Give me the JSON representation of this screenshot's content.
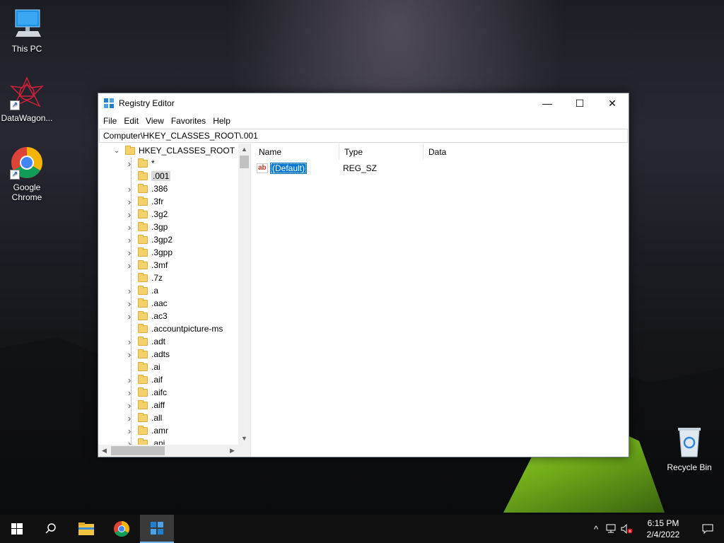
{
  "desktop": {
    "icons": [
      {
        "label": "This PC"
      },
      {
        "label": "DataWagon..."
      },
      {
        "label": "Google Chrome"
      },
      {
        "label": "Recycle Bin"
      }
    ]
  },
  "window": {
    "title": "Registry Editor",
    "controls": {
      "minimize": "—",
      "maximize": "☐",
      "close": "✕"
    },
    "menu": [
      "File",
      "Edit",
      "View",
      "Favorites",
      "Help"
    ],
    "address": "Computer\\HKEY_CLASSES_ROOT\\.001"
  },
  "tree": {
    "root": "HKEY_CLASSES_ROOT",
    "items": [
      {
        "label": "*",
        "expandable": true
      },
      {
        "label": ".001",
        "expandable": false,
        "selected": true
      },
      {
        "label": ".386",
        "expandable": true
      },
      {
        "label": ".3fr",
        "expandable": true
      },
      {
        "label": ".3g2",
        "expandable": true
      },
      {
        "label": ".3gp",
        "expandable": true
      },
      {
        "label": ".3gp2",
        "expandable": true
      },
      {
        "label": ".3gpp",
        "expandable": true
      },
      {
        "label": ".3mf",
        "expandable": true
      },
      {
        "label": ".7z",
        "expandable": false
      },
      {
        "label": ".a",
        "expandable": true
      },
      {
        "label": ".aac",
        "expandable": true
      },
      {
        "label": ".ac3",
        "expandable": true
      },
      {
        "label": ".accountpicture-ms",
        "expandable": false
      },
      {
        "label": ".adt",
        "expandable": true
      },
      {
        "label": ".adts",
        "expandable": true
      },
      {
        "label": ".ai",
        "expandable": false
      },
      {
        "label": ".aif",
        "expandable": true
      },
      {
        "label": ".aifc",
        "expandable": true
      },
      {
        "label": ".aiff",
        "expandable": true
      },
      {
        "label": ".all",
        "expandable": true
      },
      {
        "label": ".amr",
        "expandable": true
      },
      {
        "label": ".ani",
        "expandable": true
      }
    ]
  },
  "list": {
    "columns": [
      "Name",
      "Type",
      "Data"
    ],
    "rows": [
      {
        "name": "(Default)",
        "type": "REG_SZ",
        "data": "",
        "icon": "string-value-icon"
      }
    ]
  },
  "taskbar": {
    "time": "6:15 PM",
    "date": "2/4/2022"
  }
}
